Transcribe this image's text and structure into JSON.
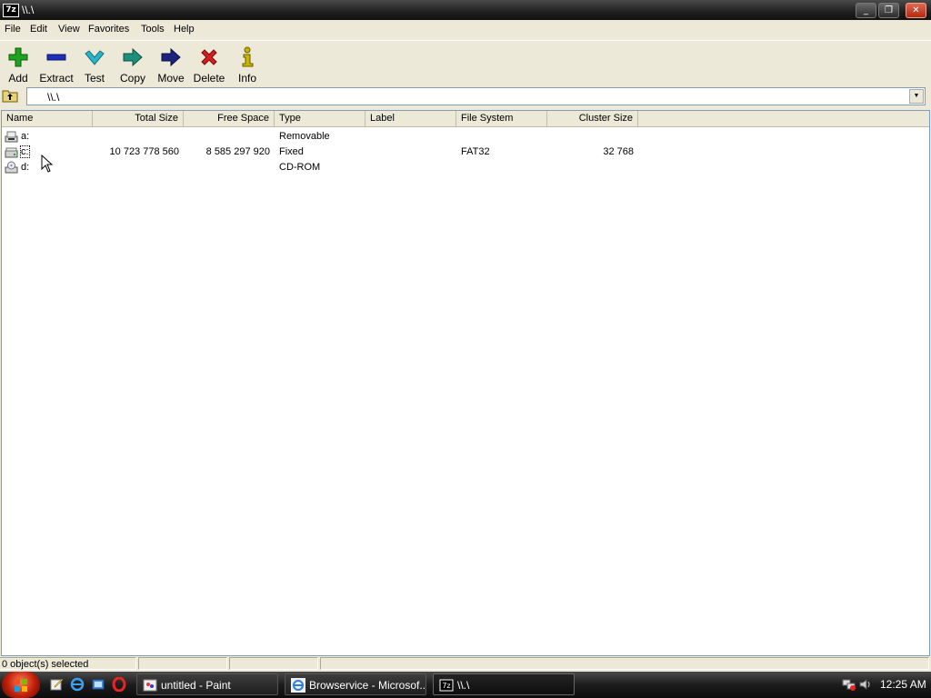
{
  "window": {
    "title": "\\\\.\\",
    "app_badge": "7z",
    "buttons": {
      "minimize": "_",
      "restore": "❐",
      "close": "✕"
    }
  },
  "menu": [
    {
      "label": "File"
    },
    {
      "label": "Edit"
    },
    {
      "label": "View"
    },
    {
      "label": "Favorites"
    },
    {
      "label": "Tools"
    },
    {
      "label": "Help"
    }
  ],
  "toolbar": [
    {
      "label": "Add",
      "icon": "plus-icon",
      "color": "#1fa21f"
    },
    {
      "label": "Extract",
      "icon": "minus-icon",
      "color": "#1c2fb8"
    },
    {
      "label": "Test",
      "icon": "check-icon",
      "color": "#2ab4c8"
    },
    {
      "label": "Copy",
      "icon": "copy-arrow-icon",
      "color": "#1e8f7a"
    },
    {
      "label": "Move",
      "icon": "move-arrow-icon",
      "color": "#1a237e"
    },
    {
      "label": "Delete",
      "icon": "x-icon",
      "color": "#d21f1f"
    },
    {
      "label": "Info",
      "icon": "info-icon",
      "color": "#c9b400"
    }
  ],
  "address": {
    "value": "\\\\.\\"
  },
  "columns": [
    {
      "label": "Name"
    },
    {
      "label": "Total Size"
    },
    {
      "label": "Free Space"
    },
    {
      "label": "Type"
    },
    {
      "label": "Label"
    },
    {
      "label": "File System"
    },
    {
      "label": "Cluster Size"
    }
  ],
  "rows": [
    {
      "name": "a:",
      "total": "",
      "free": "",
      "type": "Removable",
      "label": "",
      "fs": "",
      "cluster": "",
      "icon": "floppy-drive-icon"
    },
    {
      "name": "c:",
      "total": "10 723 778 560",
      "free": "8 585 297 920",
      "type": "Fixed",
      "label": "",
      "fs": "FAT32",
      "cluster": "32 768",
      "icon": "hard-drive-icon"
    },
    {
      "name": "d:",
      "total": "",
      "free": "",
      "type": "CD-ROM",
      "label": "",
      "fs": "",
      "cluster": "",
      "icon": "cdrom-drive-icon"
    }
  ],
  "status": {
    "selected": "0 object(s) selected"
  },
  "taskbar": {
    "tasks": [
      {
        "label": "untitled - Paint"
      },
      {
        "label": "Browservice - Microsof..."
      },
      {
        "label": "\\\\.\\"
      }
    ],
    "clock": "12:25 AM"
  }
}
